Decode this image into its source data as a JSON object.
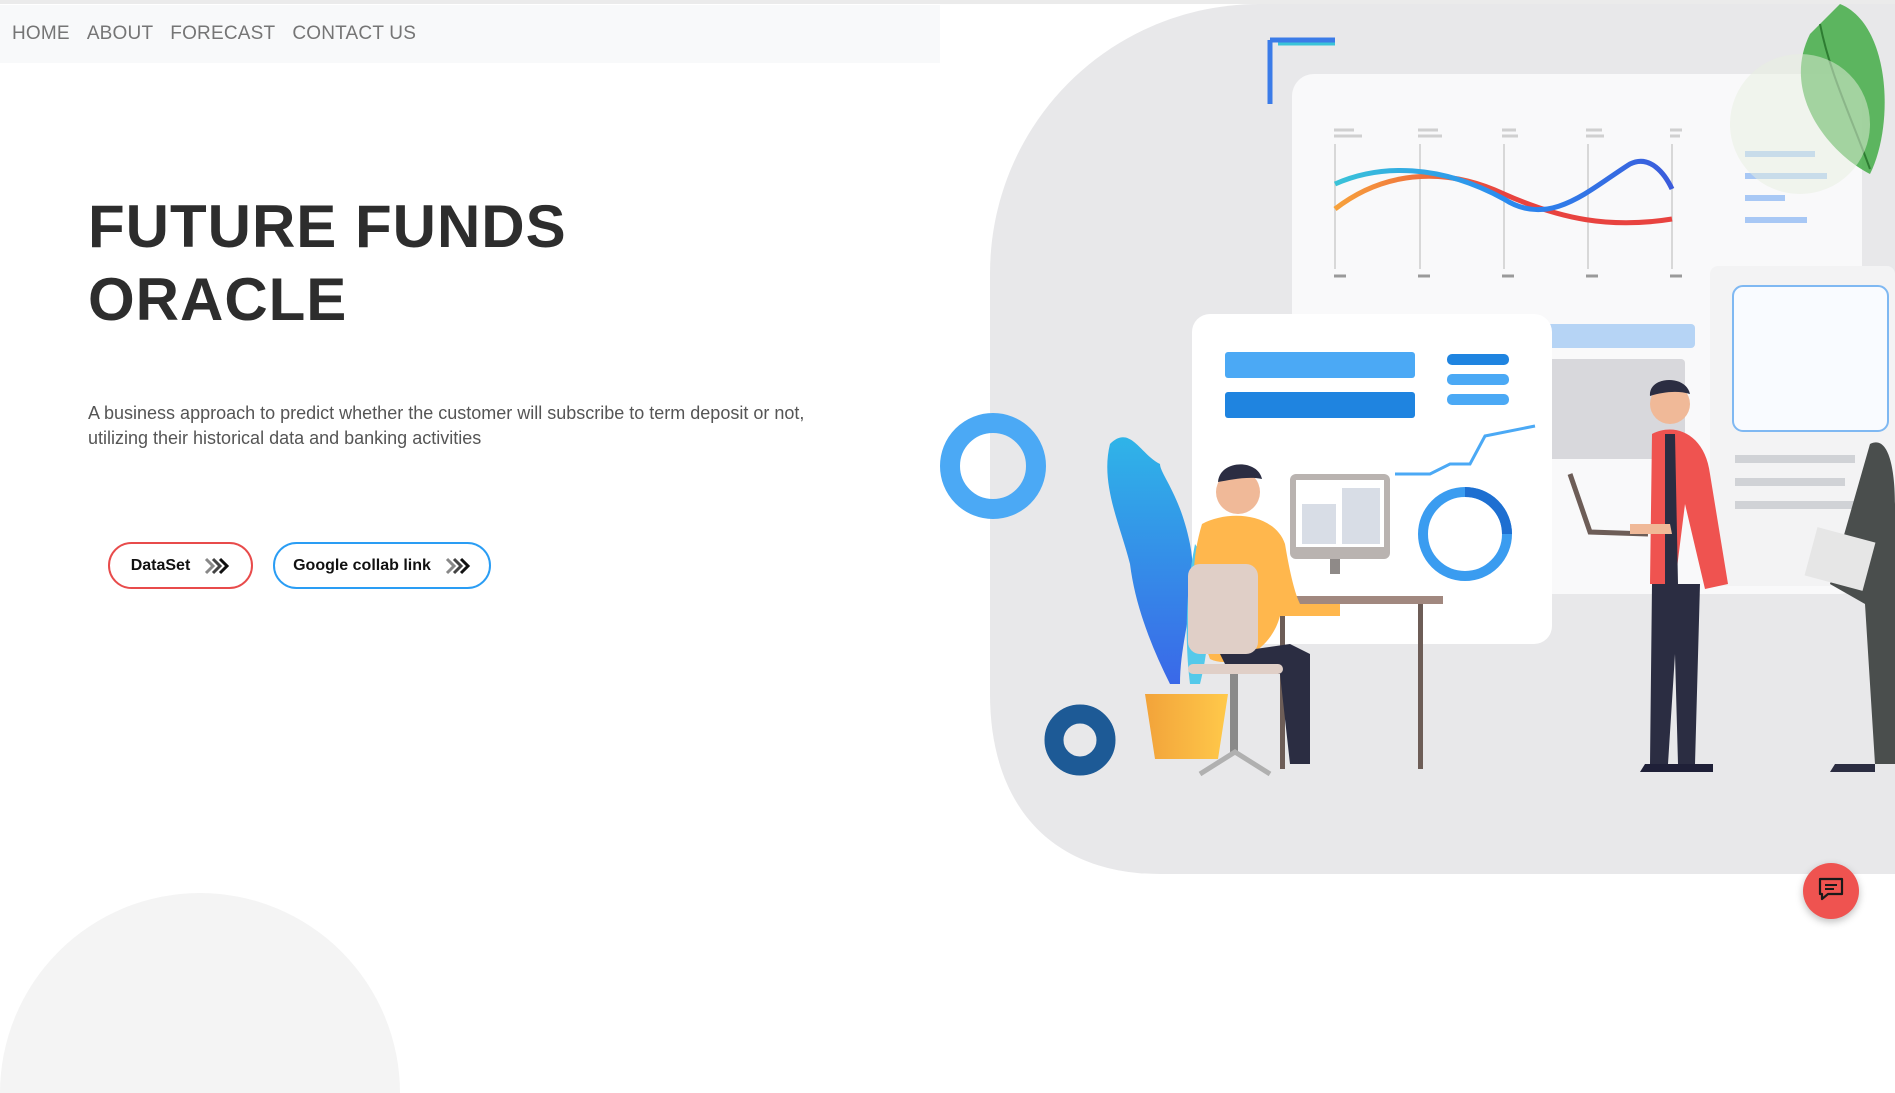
{
  "nav": {
    "items": [
      "HOME",
      "ABOUT",
      "FORECAST",
      "CONTACT US"
    ]
  },
  "hero": {
    "title_line1": "FUTURE FUNDS",
    "title_line2": "ORACLE",
    "description": "A business approach to predict whether the customer will subscribe to term deposit or not, utilizing their historical data and banking activities"
  },
  "buttons": {
    "dataset_label": "DataSet",
    "collab_label": "Google collab link"
  },
  "icons": {
    "chevrons": "double-chevron-right-icon",
    "chat": "chat-bubble-icon"
  },
  "colors": {
    "dataset_border": "#e84b4b",
    "collab_border": "#2a9df4",
    "chat_button": "#ef5350",
    "title": "#2d2d2d",
    "nav_bg": "#f8f9fa"
  }
}
